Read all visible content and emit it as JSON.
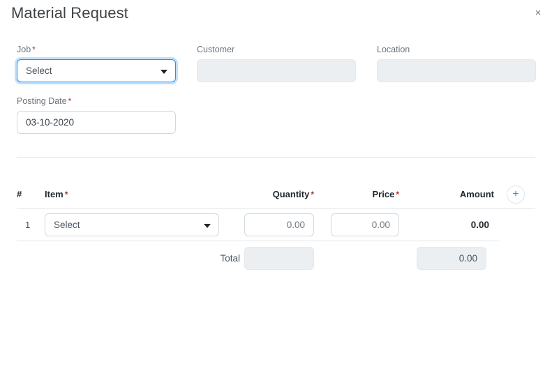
{
  "dialog": {
    "title": "Material Request",
    "close_icon": "close-icon",
    "close_label": "×"
  },
  "form": {
    "job": {
      "label": "Job",
      "required_marker": "*",
      "value": "Select",
      "caret_icon": "chevron-down-icon",
      "focused": true
    },
    "customer": {
      "label": "Customer",
      "value": "",
      "disabled": true
    },
    "location": {
      "label": "Location",
      "value": "",
      "disabled": true
    },
    "posting_date": {
      "label": "Posting Date",
      "required_marker": "*",
      "value": "03-10-2020"
    }
  },
  "items_grid": {
    "columns": {
      "index": "#",
      "item": "Item",
      "item_required": "*",
      "quantity": "Quantity",
      "quantity_required": "*",
      "price": "Price",
      "price_required": "*",
      "amount": "Amount"
    },
    "add_row_label": "+",
    "add_row_icon": "plus-icon",
    "rows": [
      {
        "index": "1",
        "item": "Select",
        "item_caret_icon": "chevron-down-icon",
        "quantity": "0.00",
        "price": "0.00",
        "amount": "0.00"
      }
    ],
    "total": {
      "label": "Total",
      "quantity": "",
      "amount": "0.00"
    }
  },
  "colors": {
    "accent": "#2490ef",
    "required": "#a93226",
    "text": "#1f272e",
    "muted": "#6c757d",
    "disabled_bg": "#eceff1",
    "border": "#d1d8dd",
    "divider": "#e2e6e9"
  }
}
